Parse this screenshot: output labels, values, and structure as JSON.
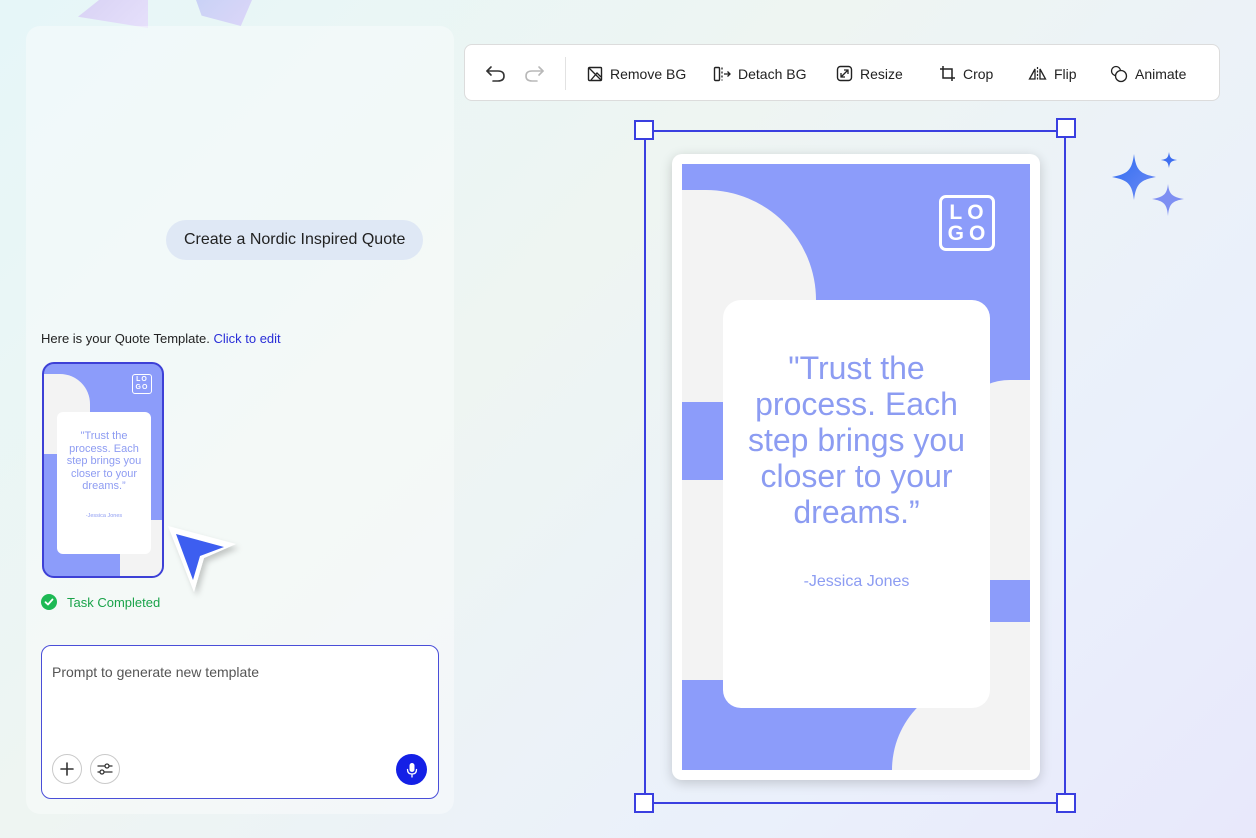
{
  "chat": {
    "user_prompt": "Create a Nordic Inspired Quote",
    "reply_prefix": "Here is your Quote Template.",
    "reply_link": "Click to edit",
    "task_status": "Task Completed",
    "prompt_placeholder": "Prompt to generate new template"
  },
  "toolbar": {
    "remove_bg": "Remove BG",
    "detach_bg": "Detach BG",
    "resize": "Resize",
    "crop": "Crop",
    "flip": "Flip",
    "animate": "Animate"
  },
  "design": {
    "logo_line1": "LO",
    "logo_line2": "GO",
    "quote": "\"Trust the process. Each step brings you closer to your dreams.”",
    "author": "-Jessica Jones",
    "colors": {
      "accent": "#8c9cfa",
      "shape": "#f3f3f3",
      "selection": "#3a3fe0",
      "quote_text": "#8c9cf2"
    }
  },
  "icons": {
    "undo": "undo-icon",
    "redo": "redo-icon",
    "remove_bg": "remove-bg-icon",
    "detach_bg": "detach-bg-icon",
    "resize": "resize-icon",
    "crop": "crop-icon",
    "flip": "flip-icon",
    "animate": "animate-icon",
    "add": "plus-icon",
    "settings": "sliders-icon",
    "mic": "mic-icon",
    "check": "check-circle-icon",
    "cursor": "cursor-arrow-icon",
    "sparkles": "sparkles-icon"
  }
}
